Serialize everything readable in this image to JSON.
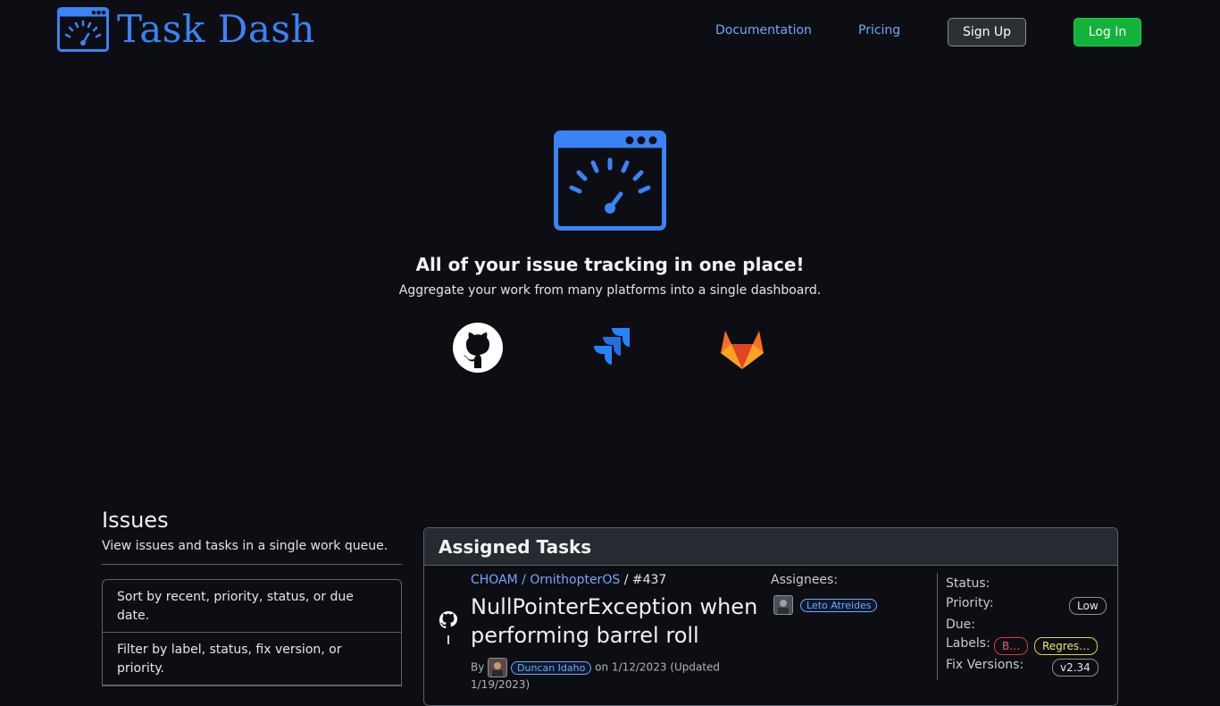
{
  "header": {
    "brand_name": "Task Dash",
    "nav": {
      "documentation": "Documentation",
      "pricing": "Pricing",
      "sign_up": "Sign Up",
      "log_in": "Log In"
    }
  },
  "hero": {
    "title": "All of your issue tracking in one place!",
    "subtitle": "Aggregate your work from many platforms into a single dashboard.",
    "platforms": [
      "github-icon",
      "jira-icon",
      "gitlab-icon"
    ]
  },
  "issues": {
    "title": "Issues",
    "subtitle": "View issues and tasks in a single work queue.",
    "features": [
      "Sort by recent, priority, status, or due date.",
      "Filter by label, status, fix version, or priority."
    ]
  },
  "assigned_tasks": {
    "title": "Assigned Tasks",
    "task": {
      "repo": "CHOAM / OrnithopterOS",
      "number": "#437",
      "title": "NullPointerException when performing barrel roll",
      "by_label": "By",
      "author": "Duncan Idaho",
      "dates": "on 1/12/2023 (Updated 1/19/2023)",
      "assignees_label": "Assignees:",
      "assignee": "Leto Atreides",
      "status_label": "Status:",
      "priority_label": "Priority:",
      "priority_value": "Low",
      "due_label": "Due:",
      "labels_label": "Labels:",
      "labels": [
        "B…",
        "Regres…"
      ],
      "fix_versions_label": "Fix Versions:",
      "fix_version": "v2.34"
    }
  },
  "colors": {
    "background": "#0d0e13",
    "brand_blue": "#3b82f6",
    "link_blue": "#6ea8fe",
    "login_green": "#12b33a"
  }
}
